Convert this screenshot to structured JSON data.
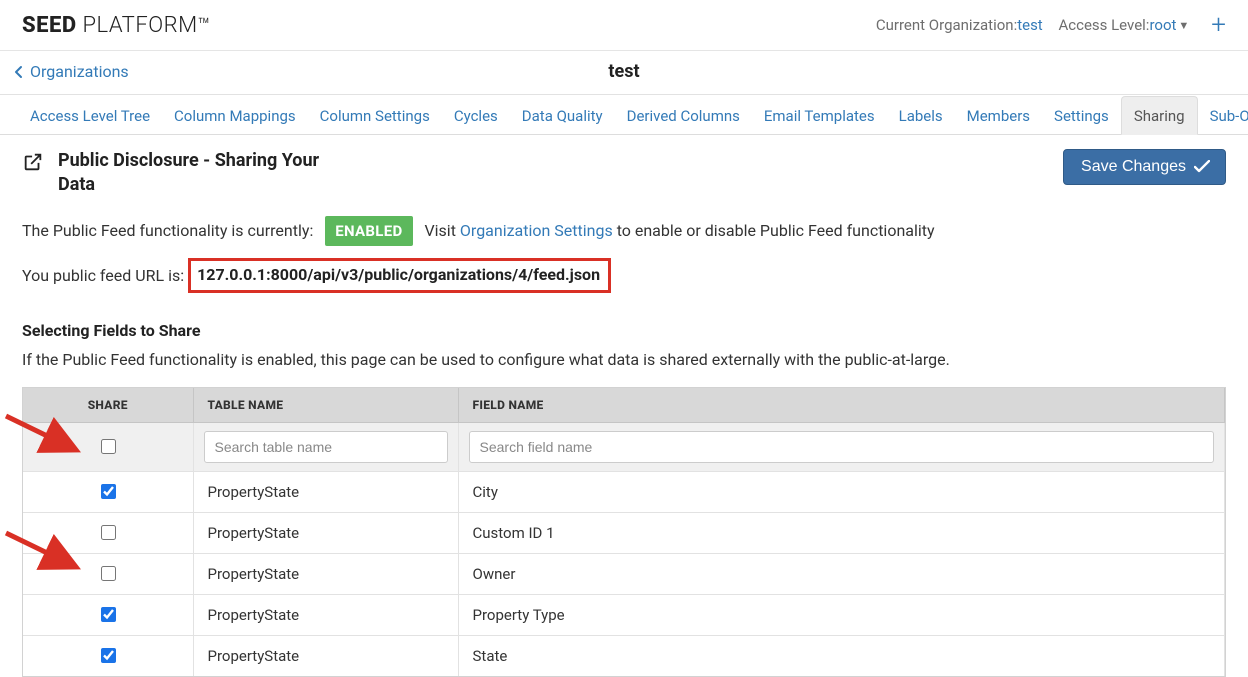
{
  "brand": {
    "bold": "SEED",
    "light": " PLATFORM",
    "tm": "™"
  },
  "header": {
    "org_label": "Current Organization: ",
    "org_name": "test",
    "access_label": "Access Level: ",
    "access_value": "root"
  },
  "crumb": {
    "back": "Organizations",
    "title": "test"
  },
  "tabs": [
    "Access Level Tree",
    "Column Mappings",
    "Column Settings",
    "Cycles",
    "Data Quality",
    "Derived Columns",
    "Email Templates",
    "Labels",
    "Members",
    "Settings",
    "Sharing",
    "Sub-Organizations"
  ],
  "active_tab": 10,
  "page": {
    "heading": "Public Disclosure - Sharing Your Data",
    "save_label": "Save Changes",
    "status_prefix": "The Public Feed functionality is currently:",
    "status_badge": "ENABLED",
    "status_visit": "Visit ",
    "status_link": "Organization Settings",
    "status_suffix": " to enable or disable Public Feed functionality",
    "url_prefix": "You public feed URL is:",
    "url_value": "127.0.0.1:8000/api/v3/public/organizations/4/feed.json",
    "subhead": "Selecting Fields to Share",
    "subdesc": "If the Public Feed functionality is enabled, this page can be used to configure what data is shared externally with the public-at-large."
  },
  "table": {
    "cols": {
      "share": "SHARE",
      "tname": "TABLE NAME",
      "fname": "FIELD NAME"
    },
    "filters": {
      "tname_ph": "Search table name",
      "fname_ph": "Search field name"
    },
    "rows": [
      {
        "checked": true,
        "tname": "PropertyState",
        "fname": "City"
      },
      {
        "checked": false,
        "tname": "PropertyState",
        "fname": "Custom ID 1"
      },
      {
        "checked": false,
        "tname": "PropertyState",
        "fname": "Owner"
      },
      {
        "checked": true,
        "tname": "PropertyState",
        "fname": "Property Type"
      },
      {
        "checked": true,
        "tname": "PropertyState",
        "fname": "State"
      }
    ]
  }
}
